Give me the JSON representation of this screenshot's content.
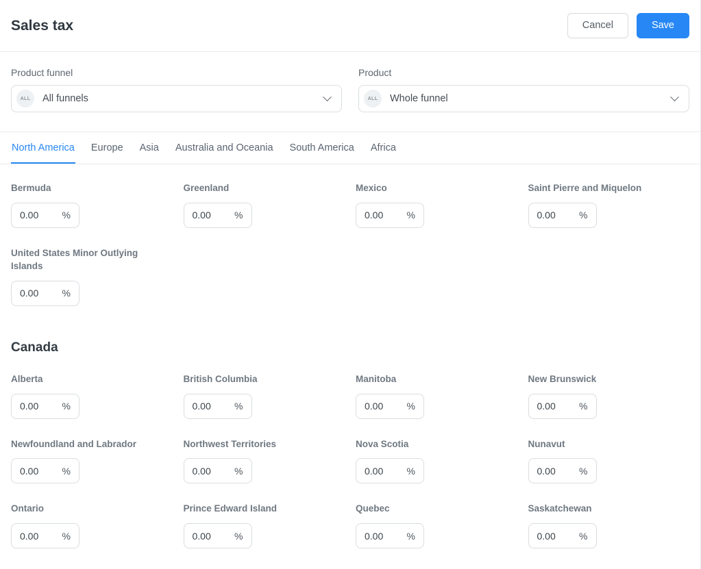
{
  "header": {
    "title": "Sales tax",
    "cancel_label": "Cancel",
    "save_label": "Save"
  },
  "filters": {
    "funnel": {
      "label": "Product funnel",
      "badge": "ALL",
      "value": "All funnels"
    },
    "product": {
      "label": "Product",
      "badge": "ALL",
      "value": "Whole funnel"
    }
  },
  "tabs": [
    {
      "label": "North America",
      "active": true
    },
    {
      "label": "Europe",
      "active": false
    },
    {
      "label": "Asia",
      "active": false
    },
    {
      "label": "Australia and Oceania",
      "active": false
    },
    {
      "label": "South America",
      "active": false
    },
    {
      "label": "Africa",
      "active": false
    }
  ],
  "tax_value": "0.00",
  "tax_suffix": "%",
  "sections": [
    {
      "heading": "",
      "regions": [
        "Bermuda",
        "Greenland",
        "Mexico",
        "Saint Pierre and Miquelon",
        "United States Minor Outlying Islands"
      ]
    },
    {
      "heading": "Canada",
      "regions": [
        "Alberta",
        "British Columbia",
        "Manitoba",
        "New Brunswick",
        "Newfoundland and Labrador",
        "Northwest Territories",
        "Nova Scotia",
        "Nunavut",
        "Ontario",
        "Prince Edward Island",
        "Quebec",
        "Saskatchewan"
      ]
    }
  ],
  "colors": {
    "accent": "#2787f5",
    "border": "#e8eaed"
  }
}
